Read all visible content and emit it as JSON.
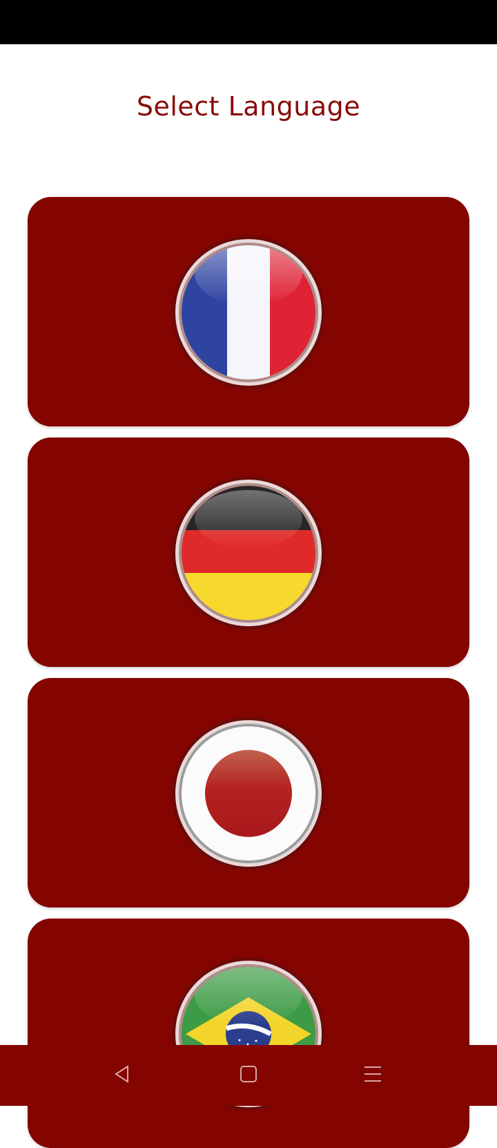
{
  "app": {
    "title": "Select Language",
    "colors": {
      "primary": "#840400",
      "title_text": "#8a0a08",
      "background": "#ffffff",
      "status_bar": "#000000",
      "nav_icon": "#d9a8a6"
    }
  },
  "languages": [
    {
      "flag_icon": "france-flag-icon"
    },
    {
      "flag_icon": "germany-flag-icon"
    },
    {
      "flag_icon": "japan-flag-icon"
    },
    {
      "flag_icon": "brazil-flag-icon"
    }
  ],
  "navigation": {
    "buttons": [
      {
        "icon": "back-triangle-icon"
      },
      {
        "icon": "home-square-icon"
      },
      {
        "icon": "menu-lines-icon"
      }
    ]
  }
}
